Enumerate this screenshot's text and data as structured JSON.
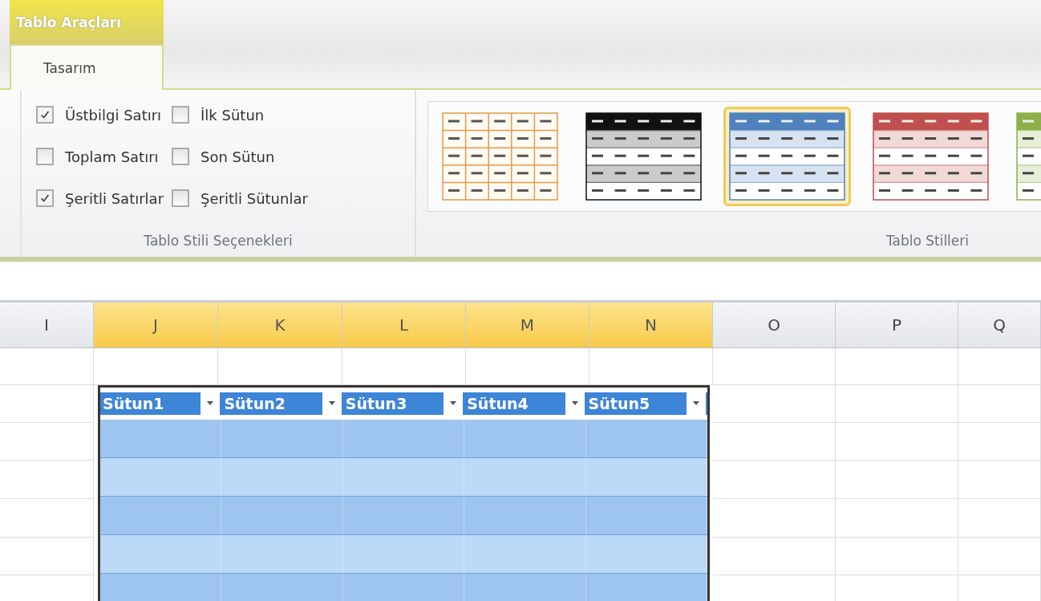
{
  "ribbon": {
    "context_tab": "Tablo Araçları",
    "tabs": [
      {
        "label": "Tasarım",
        "selected": true
      }
    ],
    "options": [
      {
        "label": "Üstbilgi Satırı",
        "checked": true
      },
      {
        "label": "Toplam Satırı",
        "checked": false
      },
      {
        "label": "Şeritli Satırlar",
        "checked": true
      },
      {
        "label": "İlk Sütun",
        "checked": false
      },
      {
        "label": "Son Sütun",
        "checked": false
      },
      {
        "label": "Şeritli Sütunlar",
        "checked": false
      }
    ],
    "options_group_label": "Tablo Stili Seçenekleri",
    "styles": [
      {
        "kind": "grid",
        "color": "#e59a4a",
        "selected": false
      },
      {
        "kind": "banded",
        "color": "#111111",
        "selected": false
      },
      {
        "kind": "banded",
        "color": "#4f81bd",
        "selected": true
      },
      {
        "kind": "banded",
        "color": "#c0504d",
        "selected": false
      },
      {
        "kind": "banded",
        "color": "#8db04a",
        "selected": false
      }
    ],
    "styles_group_label": "Tablo Stilleri"
  },
  "sheet": {
    "columns": [
      {
        "label": "I",
        "selected": false
      },
      {
        "label": "J",
        "selected": true
      },
      {
        "label": "K",
        "selected": true
      },
      {
        "label": "L",
        "selected": true
      },
      {
        "label": "M",
        "selected": true
      },
      {
        "label": "N",
        "selected": true
      },
      {
        "label": "O",
        "selected": false
      },
      {
        "label": "P",
        "selected": false
      },
      {
        "label": "Q",
        "selected": false
      }
    ],
    "table_headers": [
      "Sütun1",
      "Sütun2",
      "Sütun3",
      "Sütun4",
      "Sütun5"
    ]
  }
}
